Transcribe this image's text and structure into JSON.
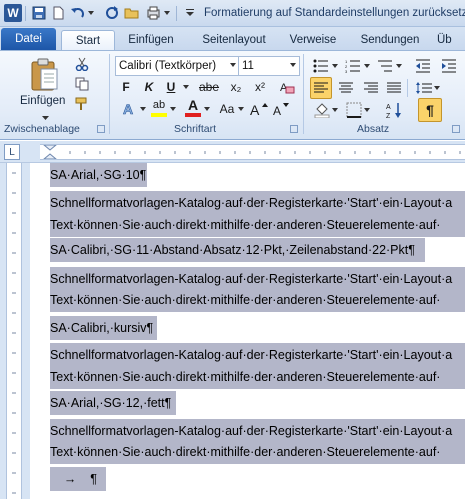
{
  "window": {
    "title": "Formatierung auf Standardeinstellungen zurücksetz",
    "app_icon": "W"
  },
  "tabs": [
    "Datei",
    "Start",
    "Einfügen",
    "Seitenlayout",
    "Verweise",
    "Sendungen",
    "Üb"
  ],
  "ribbon": {
    "clipboard": {
      "paste_label": "Einfügen",
      "group_label": "Zwischenablage"
    },
    "font": {
      "font_name": "Calibri (Textkörper)",
      "font_size": "11",
      "bold": "F",
      "italic": "K",
      "underline": "U",
      "strike": "abe",
      "subscript": "x₂",
      "superscript": "x²",
      "aa_label": "Aa",
      "highlight_label": "ab",
      "font_color_label": "A",
      "group_label": "Schriftart"
    },
    "paragraph": {
      "group_label": "Absatz",
      "pilcrow": "¶"
    }
  },
  "ruler": {
    "tab_selector": "L"
  },
  "document": {
    "lines": [
      {
        "text": "SA·Arial,·SG·10¶",
        "full": false
      },
      {
        "text": "Schnellformatvorlagen-Katalog·auf·der·Registerkarte·'Start'·ein·Layout·a",
        "full": true
      },
      {
        "text": "Text·können·Sie·auch·direkt·mithilfe·der·anderen·Steuerelemente·auf·",
        "full": true
      },
      {
        "text": "SA·Calibri,·SG·11·Abstand·Absatz·12·Pkt,·Zeilenabstand·22·Pkt¶",
        "full": false
      },
      {
        "text": "Schnellformatvorlagen-Katalog·auf·der·Registerkarte·'Start'·ein·Layout·a",
        "full": true
      },
      {
        "text": "Text·können·Sie·auch·direkt·mithilfe·der·anderen·Steuerelemente·auf·",
        "full": true
      },
      {
        "text": "SA·Calibri,·kursiv¶",
        "full": false
      },
      {
        "text": "Schnellformatvorlagen-Katalog·auf·der·Registerkarte·'Start'·ein·Layout·a",
        "full": true
      },
      {
        "text": "Text·können·Sie·auch·direkt·mithilfe·der·anderen·Steuerelemente·auf·",
        "full": true
      },
      {
        "text": "SA·Arial,·SG·12,·fett¶",
        "full": false
      },
      {
        "text": "Schnellformatvorlagen-Katalog·auf·der·Registerkarte·'Start'·ein·Layout·a",
        "full": true
      },
      {
        "text": "Text·können·Sie·auch·direkt·mithilfe·der·anderen·Steuerelemente·auf·",
        "full": true
      },
      {
        "text": "    →    ¶",
        "full": false
      }
    ]
  },
  "colors": {
    "selection": "#b3b6c9",
    "accent": "#1d56a8",
    "active_button": "#fbd36a"
  }
}
